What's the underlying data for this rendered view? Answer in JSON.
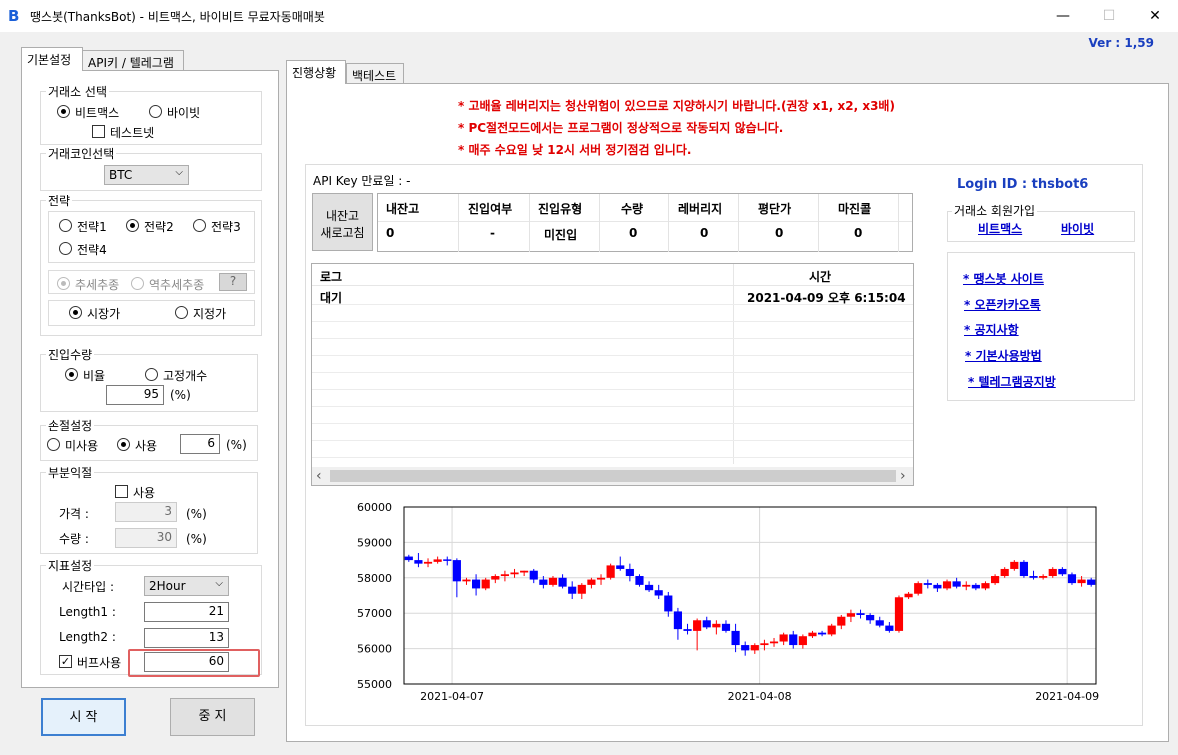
{
  "window": {
    "title": "땡스봇(ThanksBot) - 비트맥스, 바이비트 무료자동매매봇",
    "logo": "B",
    "minimize": "—",
    "maximize": "☐",
    "close": "✕",
    "version": "Ver :  1,59"
  },
  "left_tabs": [
    "기본설정",
    "API키 / 텔레그램"
  ],
  "exchange": {
    "title": "거래소 선택",
    "options": [
      "비트맥스",
      "바이빗"
    ],
    "selected": 0,
    "testnet_label": "테스트넷",
    "testnet_checked": false
  },
  "coin": {
    "title": "거래코인선택",
    "value": "BTC"
  },
  "strategy": {
    "title": "전략",
    "options": [
      "전략1",
      "전략2",
      "전략3",
      "전략4"
    ],
    "selected": 1,
    "trend_options": [
      "추세추종",
      "역추세추종"
    ],
    "trend_help": "?",
    "order_options": [
      "시장가",
      "지정가"
    ],
    "order_selected": 0
  },
  "entry": {
    "title": "진입수량",
    "options": [
      "비율",
      "고정개수"
    ],
    "selected": 0,
    "value": "95",
    "unit": "(%)"
  },
  "stoploss": {
    "title": "손절설정",
    "options": [
      "미사용",
      "사용"
    ],
    "selected": 1,
    "value": "6",
    "unit": "(%)"
  },
  "partial": {
    "title": "부분익절",
    "use_label": "사용",
    "use_checked": false,
    "price_label": "가격 :",
    "price_value": "3",
    "qty_label": "수량 :",
    "qty_value": "30",
    "unit": "(%)"
  },
  "indicator": {
    "title": "지표설정",
    "timeframe_label": "시간타입 :",
    "timeframe_value": "2Hour",
    "length1_label": "Length1 :",
    "length1_value": "21",
    "length2_label": "Length2 :",
    "length2_value": "13",
    "buffer_label": "버프사용",
    "buffer_checked": true,
    "buffer_value": "60"
  },
  "buttons": {
    "start": "시 작",
    "stop": "중 지"
  },
  "right_tabs": [
    "진행상황",
    "백테스트"
  ],
  "notices": [
    "* 고배율 레버리지는 청산위험이 있으므로 지양하시기 바랍니다.(권장 x1, x2, x3배)",
    "* PC절전모드에서는 프로그램이 정상적으로 작동되지 않습니다.",
    "* 매주 수요일 낮 12시 서버 정기점검 입니다."
  ],
  "api_expiry_label": "API Key 만료일 : -",
  "refresh_button": [
    "내잔고",
    "새로고침"
  ],
  "positions": {
    "headers": [
      "내잔고",
      "진입여부",
      "진입유형",
      "수량",
      "레버리지",
      "평단가",
      "마진콜"
    ],
    "row": [
      "0",
      "-",
      "미진입",
      "0",
      "0",
      "0",
      "0"
    ]
  },
  "login": {
    "label": "Login ID : thsbot6"
  },
  "signup": {
    "title": "거래소 회원가입",
    "links": [
      "비트맥스",
      "바이빗"
    ]
  },
  "side_links": [
    "* 땡스봇 사이트",
    "* 오픈카카오톡",
    "* 공지사항",
    "* 기본사용방법",
    "* 텔레그램공지방"
  ],
  "log": {
    "headers": [
      "로그",
      "시간"
    ],
    "rows": [
      [
        "대기",
        "2021-04-09 오후 6:15:04"
      ]
    ],
    "scroll_left": "‹",
    "scroll_right": "›"
  },
  "chart_data": {
    "type": "candlestick",
    "ylim": [
      55000,
      60000
    ],
    "yticks": [
      55000,
      56000,
      57000,
      58000,
      59000,
      60000
    ],
    "xtick_labels": [
      "2021-04-07",
      "2021-04-08",
      "2021-04-09"
    ],
    "xtick_index": [
      4.5,
      36.5,
      68.5
    ],
    "up_color": "#ff0000",
    "down_color": "#0000ff",
    "candles": [
      [
        58600,
        58650,
        58450,
        58500
      ],
      [
        58500,
        58700,
        58300,
        58400
      ],
      [
        58400,
        58550,
        58300,
        58450
      ],
      [
        58450,
        58600,
        58400,
        58520
      ],
      [
        58520,
        58600,
        58350,
        58500
      ],
      [
        58500,
        58550,
        57450,
        57900
      ],
      [
        57900,
        58000,
        57800,
        57950
      ],
      [
        57950,
        58100,
        57500,
        57700
      ],
      [
        57700,
        58000,
        57650,
        57950
      ],
      [
        57950,
        58100,
        57850,
        58050
      ],
      [
        58050,
        58200,
        57900,
        58100
      ],
      [
        58100,
        58250,
        58000,
        58150
      ],
      [
        58150,
        58200,
        58050,
        58200
      ],
      [
        58200,
        58250,
        57850,
        57950
      ],
      [
        57950,
        58050,
        57700,
        57800
      ],
      [
        57800,
        58050,
        57750,
        58000
      ],
      [
        58000,
        58100,
        57700,
        57750
      ],
      [
        57750,
        57900,
        57400,
        57550
      ],
      [
        57550,
        57850,
        57400,
        57800
      ],
      [
        57800,
        58000,
        57700,
        57950
      ],
      [
        57950,
        58100,
        57800,
        58000
      ],
      [
        58000,
        58400,
        57950,
        58350
      ],
      [
        58350,
        58600,
        58200,
        58250
      ],
      [
        58250,
        58400,
        57900,
        58050
      ],
      [
        58050,
        58100,
        57750,
        57800
      ],
      [
        57800,
        57900,
        57600,
        57650
      ],
      [
        57650,
        57800,
        57400,
        57500
      ],
      [
        57500,
        57600,
        56900,
        57050
      ],
      [
        57050,
        57150,
        56250,
        56550
      ],
      [
        56550,
        56700,
        56400,
        56500
      ],
      [
        56500,
        56850,
        55950,
        56800
      ],
      [
        56800,
        56900,
        56550,
        56600
      ],
      [
        56600,
        56800,
        56400,
        56700
      ],
      [
        56700,
        56800,
        56450,
        56500
      ],
      [
        56500,
        56700,
        55900,
        56100
      ],
      [
        56100,
        56200,
        55800,
        55950
      ],
      [
        55950,
        56150,
        55850,
        56100
      ],
      [
        56100,
        56250,
        55950,
        56150
      ],
      [
        56150,
        56300,
        56050,
        56200
      ],
      [
        56200,
        56450,
        56100,
        56400
      ],
      [
        56400,
        56500,
        56000,
        56100
      ],
      [
        56100,
        56400,
        56000,
        56350
      ],
      [
        56350,
        56500,
        56300,
        56450
      ],
      [
        56450,
        56500,
        56350,
        56400
      ],
      [
        56400,
        56700,
        56350,
        56650
      ],
      [
        56650,
        56950,
        56550,
        56900
      ],
      [
        56900,
        57100,
        56750,
        57000
      ],
      [
        57000,
        57100,
        56850,
        56950
      ],
      [
        56950,
        57000,
        56700,
        56800
      ],
      [
        56800,
        56900,
        56600,
        56650
      ],
      [
        56650,
        56750,
        56450,
        56500
      ],
      [
        56500,
        57500,
        56450,
        57450
      ],
      [
        57450,
        57600,
        57400,
        57550
      ],
      [
        57550,
        57900,
        57500,
        57850
      ],
      [
        57850,
        57950,
        57700,
        57800
      ],
      [
        57800,
        57850,
        57600,
        57700
      ],
      [
        57700,
        57950,
        57650,
        57900
      ],
      [
        57900,
        58000,
        57700,
        57750
      ],
      [
        57750,
        57900,
        57650,
        57800
      ],
      [
        57800,
        57850,
        57650,
        57700
      ],
      [
        57700,
        57900,
        57650,
        57850
      ],
      [
        57850,
        58100,
        57800,
        58050
      ],
      [
        58050,
        58300,
        58000,
        58250
      ],
      [
        58250,
        58500,
        58200,
        58450
      ],
      [
        58450,
        58500,
        58000,
        58050
      ],
      [
        58050,
        58200,
        57950,
        58000
      ],
      [
        58000,
        58100,
        57950,
        58050
      ],
      [
        58050,
        58300,
        58000,
        58250
      ],
      [
        58250,
        58300,
        58050,
        58100
      ],
      [
        58100,
        58150,
        57800,
        57850
      ],
      [
        57850,
        58050,
        57750,
        57950
      ],
      [
        57950,
        58000,
        57750,
        57800
      ]
    ]
  }
}
